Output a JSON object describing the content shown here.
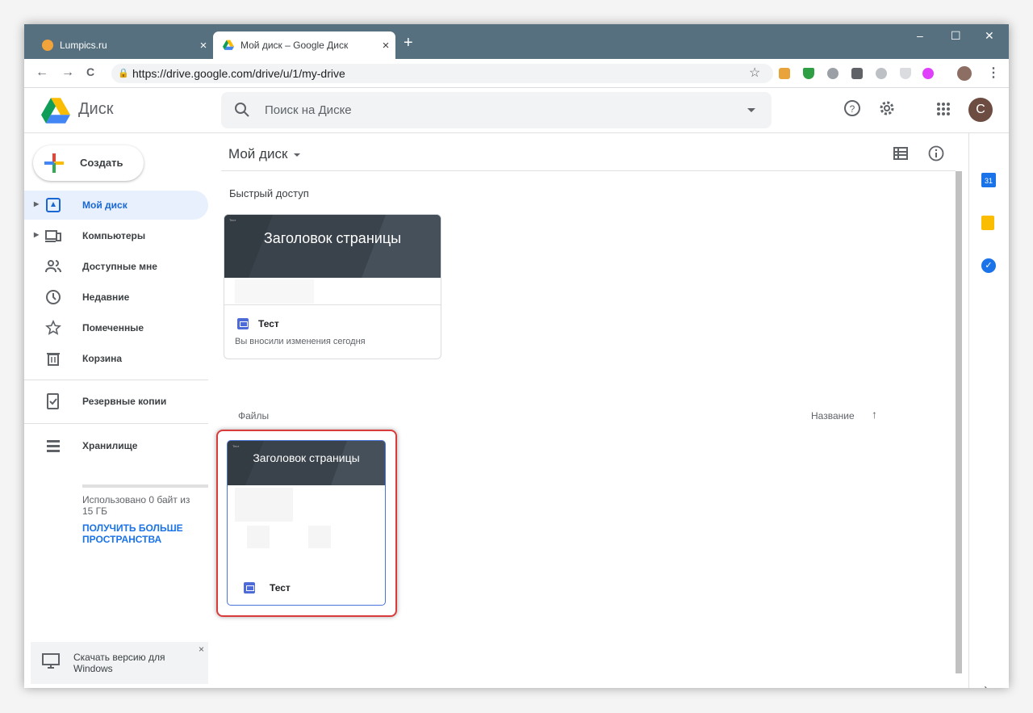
{
  "browser": {
    "tabs": [
      {
        "title": "Lumpics.ru",
        "close": "×"
      },
      {
        "title": "Мой диск – Google Диск",
        "close": "×"
      }
    ],
    "new_tab": "+",
    "window_controls": [
      "–",
      "☐",
      "✕"
    ],
    "nav": {
      "back": "←",
      "forward": "→",
      "reload": "C"
    },
    "url": "https://drive.google.com/drive/u/1/my-drive",
    "bookmark_star": "☆",
    "menu": "⋮"
  },
  "header": {
    "brand": "Диск",
    "search_placeholder": "Поиск на Диске",
    "avatar_letter": "C"
  },
  "sidebar": {
    "create_label": "Создать",
    "items": [
      {
        "label": "Мой диск",
        "active": true
      },
      {
        "label": "Компьютеры"
      },
      {
        "label": "Доступные мне"
      },
      {
        "label": "Недавние"
      },
      {
        "label": "Помеченные"
      },
      {
        "label": "Корзина"
      },
      {
        "label": "Резервные копии"
      },
      {
        "label": "Хранилище"
      }
    ],
    "storage_used": "Использовано 0 байт из 15 ГБ",
    "storage_link": "ПОЛУЧИТЬ БОЛЬШЕ ПРОСТРАНСТВА",
    "download_text": "Скачать версию для Windows",
    "download_close": "×"
  },
  "main": {
    "title": "Мой диск",
    "quick_access_label": "Быстрый доступ",
    "quick_card": {
      "thumb_title": "Заголовок страницы",
      "name": "Тест",
      "subtitle": "Вы вносили изменения сегодня"
    },
    "files_label": "Файлы",
    "sort_label": "Название",
    "sort_arrow": "↑",
    "file_card": {
      "thumb_title": "Заголовок страницы",
      "name": "Тест"
    }
  },
  "right_panel": {
    "expand": "›",
    "calendar_day": "31"
  },
  "colors": {
    "accent": "#1a73e8",
    "active_bg": "#e8f0fe",
    "highlight": "#d93a3a",
    "tabbar": "#56707f"
  }
}
